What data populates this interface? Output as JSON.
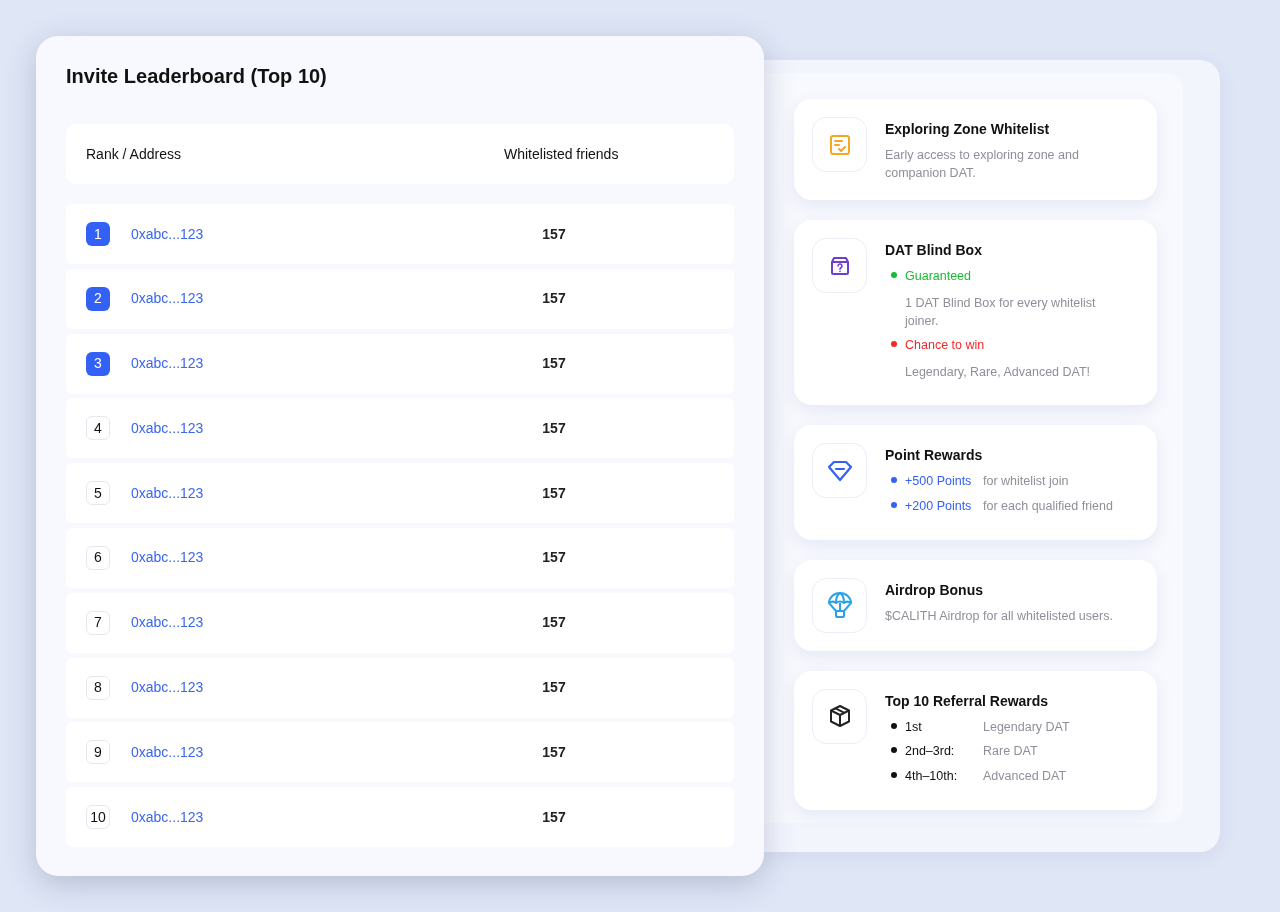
{
  "leaderboard": {
    "title": "Invite Leaderboard (Top 10)",
    "columns": [
      "Rank / Address",
      "Whitelisted friends"
    ],
    "rows": [
      {
        "rank": "1",
        "address": "0xabc...123",
        "count": "157",
        "top": true
      },
      {
        "rank": "2",
        "address": "0xabc...123",
        "count": "157",
        "top": true
      },
      {
        "rank": "3",
        "address": "0xabc...123",
        "count": "157",
        "top": true
      },
      {
        "rank": "4",
        "address": "0xabc...123",
        "count": "157",
        "top": false
      },
      {
        "rank": "5",
        "address": "0xabc...123",
        "count": "157",
        "top": false
      },
      {
        "rank": "6",
        "address": "0xabc...123",
        "count": "157",
        "top": false
      },
      {
        "rank": "7",
        "address": "0xabc...123",
        "count": "157",
        "top": false
      },
      {
        "rank": "8",
        "address": "0xabc...123",
        "count": "157",
        "top": false
      },
      {
        "rank": "9",
        "address": "0xabc...123",
        "count": "157",
        "top": false
      },
      {
        "rank": "10",
        "address": "0xabc...123",
        "count": "157",
        "top": false
      }
    ]
  },
  "rewards": [
    {
      "title": "Exploring Zone Whitelist",
      "kind": "text",
      "description": "Early access to exploring zone and companion DAT."
    },
    {
      "title": "DAT Blind Box",
      "kind": "stacked",
      "items": [
        {
          "label": "Guaranteed",
          "detail": "1 DAT Blind Box for every whitelist joiner.",
          "color": "#1bb934"
        },
        {
          "label": "Chance to win",
          "detail": "Legendary, Rare, Advanced  DAT!",
          "color": "#f02a2a"
        }
      ]
    },
    {
      "title": "Point Rewards",
      "kind": "inline",
      "items": [
        {
          "label": "+500 Points",
          "detail": "for whitelist join",
          "color": "#3361f5"
        },
        {
          "label": "+200 Points",
          "detail": "for each qualified friend",
          "color": "#3361f5"
        }
      ]
    },
    {
      "title": "Airdrop Bonus",
      "kind": "text",
      "description": "$CALITH Airdrop for all whitelisted users."
    },
    {
      "title": "Top 10 Referral Rewards",
      "kind": "inline",
      "items": [
        {
          "label": "1st",
          "detail": "Legendary DAT",
          "color": "#111111"
        },
        {
          "label": "2nd–3rd:",
          "detail": "Rare DAT",
          "color": "#111111"
        },
        {
          "label": "4th–10th:",
          "detail": "Advanced DAT",
          "color": "#111111"
        }
      ]
    }
  ]
}
